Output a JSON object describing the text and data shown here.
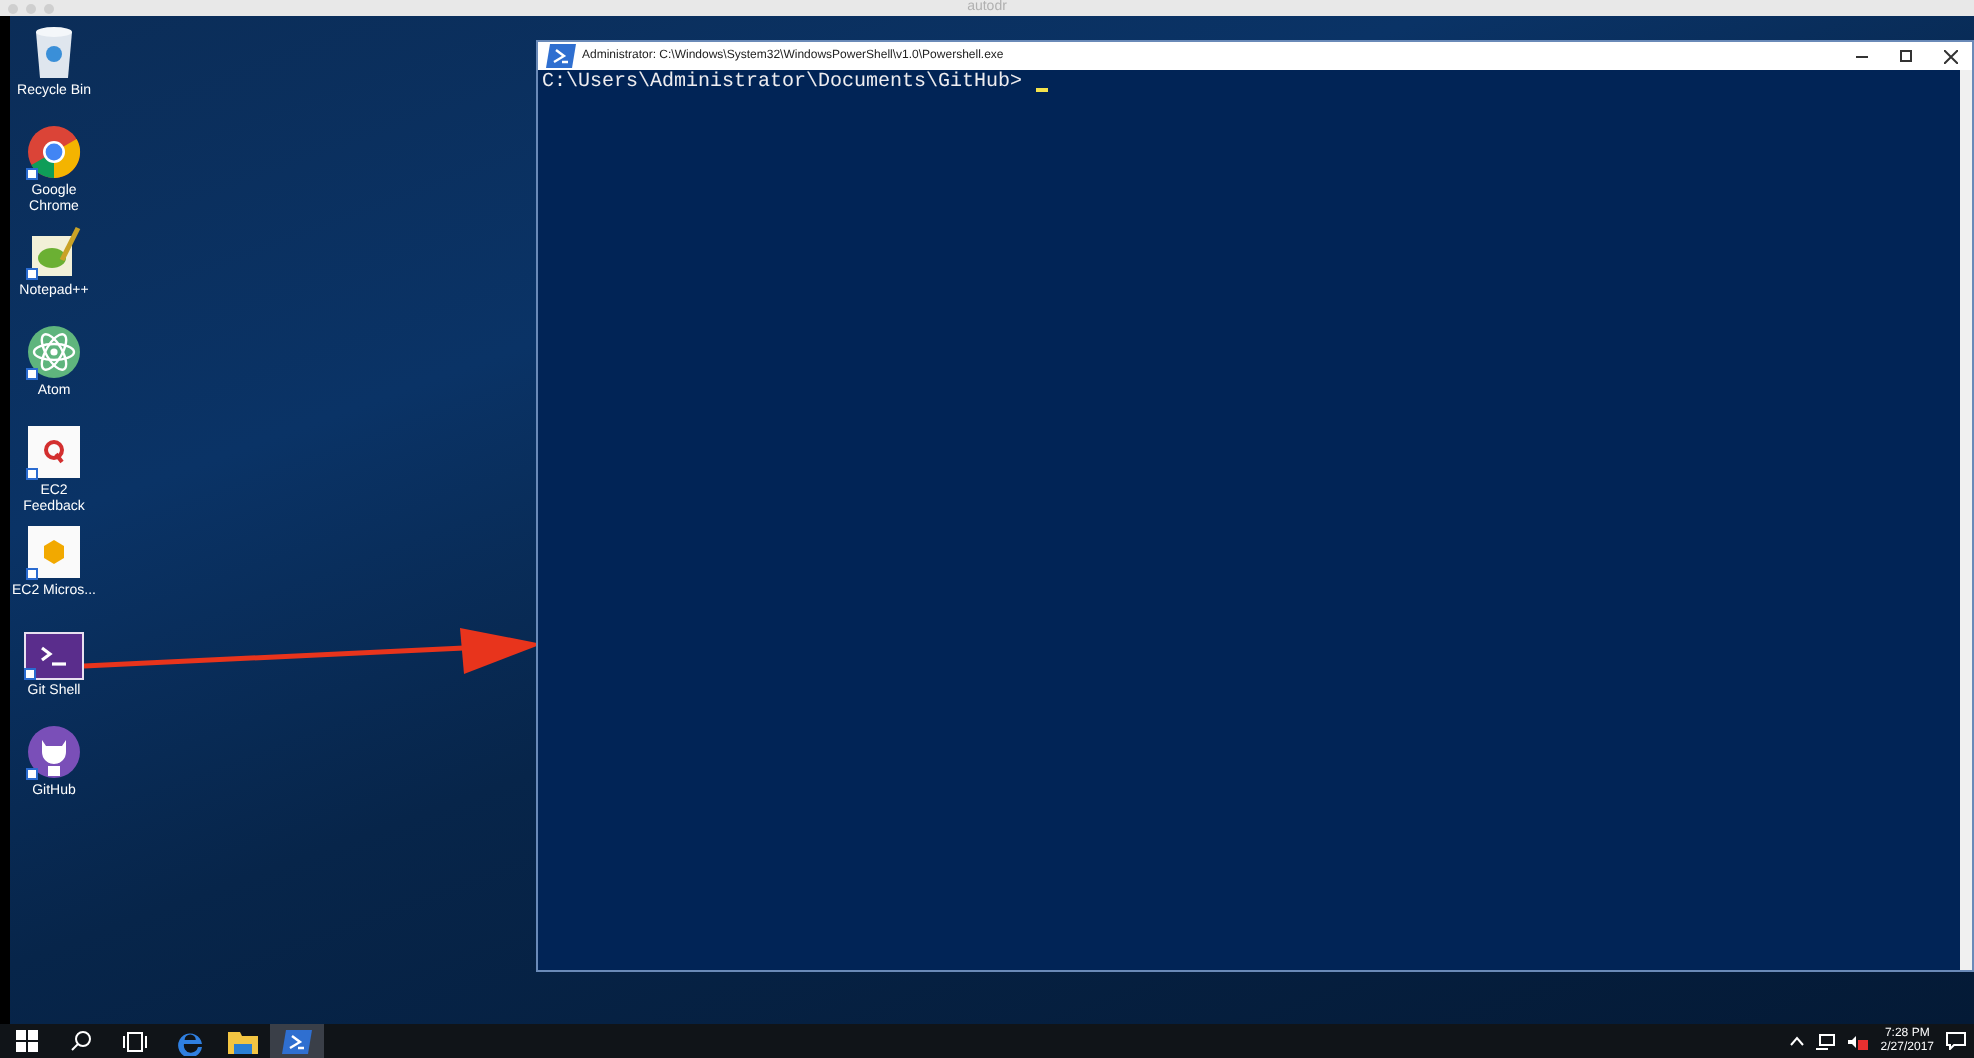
{
  "window": {
    "title": "autodr"
  },
  "desktop_icons": [
    {
      "label": "Recycle Bin",
      "kind": "recycle",
      "shortcut": false
    },
    {
      "label": "Google Chrome",
      "kind": "chrome",
      "shortcut": true
    },
    {
      "label": "Notepad++",
      "kind": "notepad",
      "shortcut": true
    },
    {
      "label": "Atom",
      "kind": "atom",
      "shortcut": true
    },
    {
      "label": "EC2 Feedback",
      "kind": "feedback",
      "shortcut": true
    },
    {
      "label": "EC2 Micros...",
      "kind": "box",
      "shortcut": true
    },
    {
      "label": "Git Shell",
      "kind": "shell",
      "shortcut": true
    },
    {
      "label": "GitHub",
      "kind": "github",
      "shortcut": true
    }
  ],
  "console": {
    "title": "Administrator: C:\\Windows\\System32\\WindowsPowerShell\\v1.0\\Powershell.exe",
    "prompt": "C:\\Users\\Administrator\\Documents\\GitHub>"
  },
  "taskbar": {
    "items": [
      {
        "kind": "start",
        "selected": false
      },
      {
        "kind": "search",
        "selected": false
      },
      {
        "kind": "taskview",
        "selected": false
      },
      {
        "kind": "edge",
        "selected": false
      },
      {
        "kind": "explorer",
        "selected": false
      },
      {
        "kind": "powershell",
        "selected": true
      }
    ],
    "clock": {
      "time": "7:28 PM",
      "date": "2/27/2017"
    }
  }
}
